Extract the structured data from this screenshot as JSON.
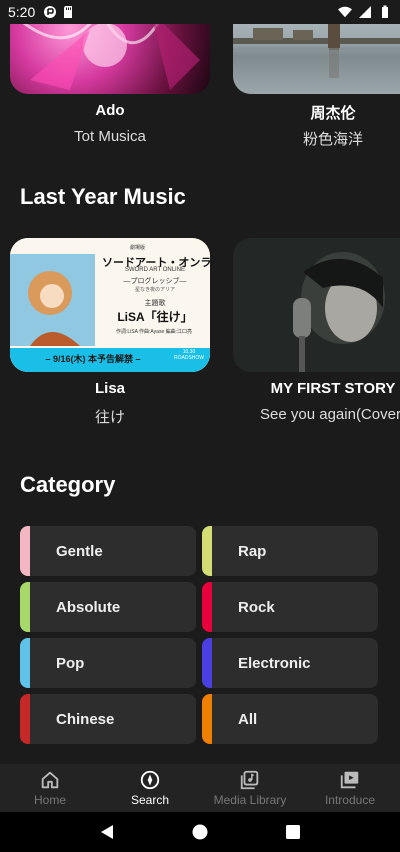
{
  "status": {
    "time": "5:20"
  },
  "top_row": [
    {
      "artist": "Ado",
      "song": "Tot Musica"
    },
    {
      "artist": "周杰伦",
      "song": "粉色海洋"
    }
  ],
  "last_year": {
    "title": "Last Year Music",
    "items": [
      {
        "artist": "Lisa",
        "song": "往け",
        "poster": {
          "line1": "劇場版",
          "line2": "ソードアート・オンライン",
          "line3": "SWORD ART ONLINE",
          "line4": "―プログレッシブ―",
          "line5": "星なき夜のアリア",
          "line6": "主題歌",
          "line7": "LiSA「往け」",
          "line8": "作詞:LiSA 作曲:Ayase 編曲:江口亮",
          "banner": "– 9/16(木) 本予告解禁 –",
          "banner_right": "10.30 ROADSHOW"
        }
      },
      {
        "artist": "MY FIRST STORY",
        "song": "See you again(Cover)"
      }
    ]
  },
  "category": {
    "title": "Category",
    "items": [
      {
        "label": "Gentle",
        "color": "#f4b6c2"
      },
      {
        "label": "Rap",
        "color": "#d4dc74"
      },
      {
        "label": "Absolute",
        "color": "#a6d96a"
      },
      {
        "label": "Rock",
        "color": "#e8003d"
      },
      {
        "label": "Pop",
        "color": "#5ec3e6"
      },
      {
        "label": "Electronic",
        "color": "#4a3fe0"
      },
      {
        "label": "Chinese",
        "color": "#c62828"
      },
      {
        "label": "All",
        "color": "#ef7f00"
      }
    ]
  },
  "bottom_nav": [
    {
      "label": "Home",
      "icon": "home-icon"
    },
    {
      "label": "Search",
      "icon": "compass-icon"
    },
    {
      "label": "Media Library",
      "icon": "media-library-icon"
    },
    {
      "label": "Introduce",
      "icon": "introduce-icon"
    }
  ],
  "active_tab": "Search"
}
